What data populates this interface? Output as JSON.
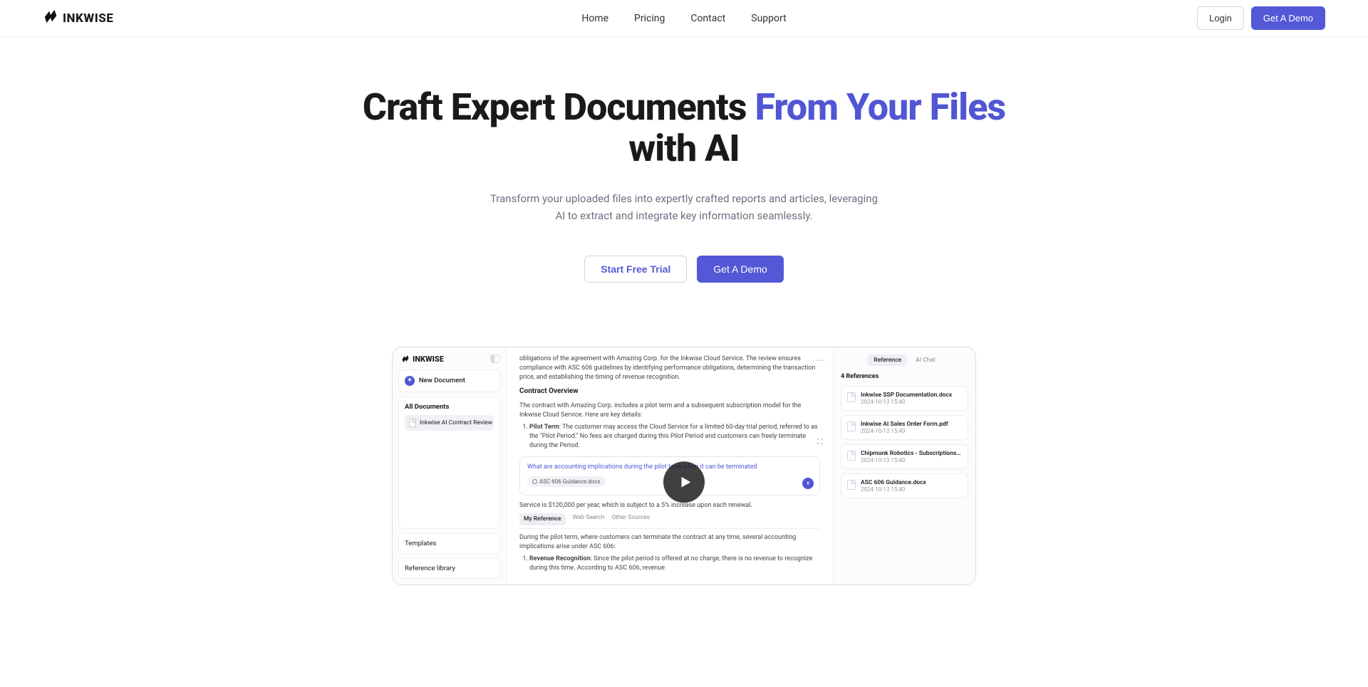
{
  "brand": "INKWISE",
  "nav": {
    "home": "Home",
    "pricing": "Pricing",
    "contact": "Contact",
    "support": "Support"
  },
  "header": {
    "login": "Login",
    "demo": "Get A Demo"
  },
  "hero": {
    "title_part1": "Craft Expert Documents ",
    "title_accent": "From Your Files",
    "title_part2": " with AI",
    "subtitle": "Transform your uploaded files into expertly crafted reports and articles, leveraging AI to extract and integrate key information seamlessly.",
    "cta_trial": "Start Free Trial",
    "cta_demo": "Get A Demo"
  },
  "preview": {
    "sidebar": {
      "brand": "INKWISE",
      "new_document": "New Document",
      "all_documents": "All Documents",
      "doc": "Inkwise AI Contract Review ...",
      "templates": "Templates",
      "reference_library": "Reference library"
    },
    "main": {
      "intro": "obligations of the agreement with Amazing Corp. for the Inkwise Cloud Service. The review ensures compliance with ASC 606 guidelines by identifying performance obligations, determining the transaction price, and establishing the timing of revenue recognition.",
      "overview_heading": "Contract Overview",
      "overview_text": "The contract with Amazing Corp. includes a pilot term and a subsequent subscription model for the Inkwise Cloud Service. Here are key details:",
      "item1_label": "Pilot Term",
      "item1_text": ": The customer may access the Cloud Service for a limited 60-day trial period, referred to as the \"Pilot Period.\" No fees are charged during this Pilot Period and customers can freely terminate during the Period.",
      "prompt": "What are accounting implications during the pilot term when it can be terminated",
      "chip": "ASC 606 Guidance.docx",
      "price_line": "Service is $120,000 per year, which is subject to a 5% increase upon each renewal.",
      "tabs": {
        "myref": "My Reference",
        "web": "Web Search",
        "other": "Other Sources"
      },
      "rr_text": "During the pilot term, where customers can terminate the contract at any time, several accounting implications arise under ASC 606:",
      "item2_label": "Revenue Recognition",
      "item2_text": ": Since the pilot period is offered at no charge, there is no revenue to recognize during this time. According to ASC 606, revenue"
    },
    "right": {
      "tabs": {
        "reference": "Reference",
        "aichat": "AI Chat"
      },
      "count_label": "4 References",
      "items": [
        {
          "name": "Inkwise SSP Documentation.docx",
          "date": "2024-10-13 15:40"
        },
        {
          "name": "Inkwise AI Sales Order Form.pdf",
          "date": "2024-10-13 15:40"
        },
        {
          "name": "Chipmunk Robotics - Subscriptions Term...",
          "date": "2024-10-13 15:40"
        },
        {
          "name": "ASC 606 Guidance.docx",
          "date": "2024-10-13 15:40"
        }
      ]
    }
  }
}
